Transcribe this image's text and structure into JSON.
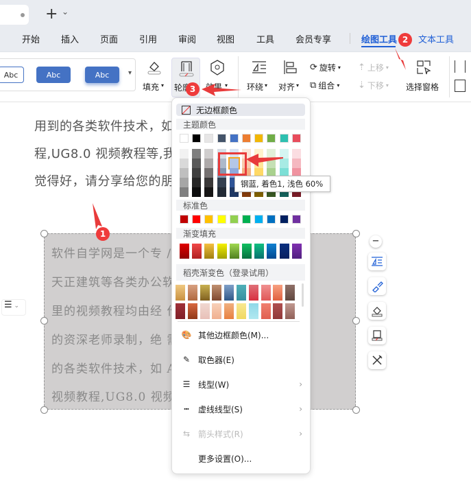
{
  "tabbar": {
    "new_tab": "+",
    "new_tab_menu": "⌄"
  },
  "menu": {
    "items": [
      "开始",
      "插入",
      "页面",
      "引用",
      "审阅",
      "视图",
      "工具",
      "会员专享"
    ],
    "drawing_tools": "绘图工具",
    "text_tools": "文本工具"
  },
  "ribbon": {
    "styles": [
      "Abc",
      "Abc",
      "Abc"
    ],
    "fill": "填充",
    "outline": "轮廓",
    "effect": "效果",
    "wrap": "环绕",
    "align": "对齐",
    "rotate": "旋转",
    "group": "组合",
    "move_up": "上移",
    "move_down": "下移",
    "selection_pane": "选择窗格"
  },
  "document": {
    "lines": [
      "用到的各类软件技术，如                           程,Pro/E5.0 视频教",
      "程,UG8.0 视频教程等,我                          软件自学网。如果您",
      "觉得好，请分享给您的朋"
    ]
  },
  "textbox": {
    "lines": [
      "软件自学网是一个专                          /E, PS,",
      "天正建筑等各类办公软                        ，本站",
      "里的视频教程均由经                          作经验",
      "的资深老师录制，绝                          需用到",
      "的各类软件技术，如 A                        o/E5.0",
      "视频教程,UG8.0 视频"
    ]
  },
  "dropdown": {
    "no_border": "无边框颜色",
    "theme_header": "主题颜色",
    "standard_header": "标准色",
    "gradient_header": "渐变填充",
    "docer_header": "稻壳渐变色（登录试用）",
    "theme_colors": [
      "#ffffff",
      "#000000",
      "#e7e6e6",
      "#44546a",
      "#4472c4",
      "#ed7d31",
      "#f2b705",
      "#70ad47",
      "#2ec0b0",
      "#e84c5c"
    ],
    "shades": [
      [
        "#f2f2f2",
        "#d9d9d9",
        "#bfbfbf",
        "#a6a6a6",
        "#808080"
      ],
      [
        "#7f7f7f",
        "#595959",
        "#3f3f3f",
        "#262626",
        "#0d0d0d"
      ],
      [
        "#d0cece",
        "#aeaaaa",
        "#757171",
        "#3a3838",
        "#171616"
      ],
      [
        "#d6dce4",
        "#adb9ca",
        "#8497b0",
        "#333f4f",
        "#222a35"
      ],
      [
        "#dae3f3",
        "#b4c7e7",
        "#8faadc",
        "#2f5597",
        "#1f3864"
      ],
      [
        "#fbe5d6",
        "#f8cbad",
        "#f4b183",
        "#c55a11",
        "#843c0c"
      ],
      [
        "#fff2cc",
        "#ffe699",
        "#ffd966",
        "#bf9000",
        "#7f6000"
      ],
      [
        "#e2f0d9",
        "#c5e0b4",
        "#a9d18e",
        "#548235",
        "#385723"
      ],
      [
        "#d5f5f2",
        "#a8ebe4",
        "#7ddfd6",
        "#1e9087",
        "#14605a"
      ],
      [
        "#fbdde1",
        "#f5b8c0",
        "#f093a0",
        "#b42a3a",
        "#781c27"
      ]
    ],
    "selected": {
      "column": 4,
      "row": 1
    },
    "standard_colors": [
      "#c00000",
      "#ff0000",
      "#ffc000",
      "#ffff00",
      "#92d050",
      "#00b050",
      "#00b0f0",
      "#0070c0",
      "#002060",
      "#7030a0"
    ],
    "gradients": [
      [
        "#e00000",
        "#900000"
      ],
      [
        "#f04848",
        "#b02020"
      ],
      [
        "#f5c040",
        "#a08010"
      ],
      [
        "#f5f000",
        "#a0a000"
      ],
      [
        "#a0d850",
        "#508020"
      ],
      [
        "#10c060",
        "#087040"
      ],
      [
        "#10c080",
        "#087070"
      ],
      [
        "#1080d0",
        "#004890"
      ],
      [
        "#0a3080",
        "#0a2060"
      ],
      [
        "#8030b0",
        "#502080"
      ]
    ],
    "docer_row1": [
      [
        "#f0c880",
        "#c89040"
      ],
      [
        "#d8a080",
        "#b06840"
      ],
      [
        "#c8b050",
        "#806020"
      ],
      [
        "#c09070",
        "#804830"
      ],
      [
        "#80a0c8",
        "#305888"
      ],
      [
        "#50b0b8",
        "#3890a0"
      ],
      [
        "#e07078",
        "#d83040"
      ],
      [
        "#f09090",
        "#e05858"
      ],
      [
        "#f8a080",
        "#e06040"
      ],
      [
        "#907068",
        "#604840"
      ]
    ],
    "docer_row2": [
      [
        "#a03038",
        "#802028"
      ],
      [
        "#d86840",
        "#903818"
      ],
      [
        "#f0d8d0",
        "#e8c0b8"
      ],
      [
        "#f8d0b8",
        "#f0b090"
      ],
      [
        "#f0b080",
        "#e88040"
      ],
      [
        "#f8e890",
        "#f0d860"
      ],
      [
        "#90d8e8",
        "#b0e8f0"
      ],
      [
        "#f08070",
        "#e06050"
      ],
      [
        "#b05050",
        "#903838"
      ],
      [
        "#c09890",
        "#906058"
      ]
    ],
    "tooltip": "钢蓝, 着色1, 浅色 60%",
    "items": [
      {
        "label": "其他边框颜色(M)...",
        "icon": "palette-icon"
      },
      {
        "label": "取色器(E)",
        "icon": "eyedropper-icon"
      },
      {
        "label": "线型(W)",
        "icon": "line-weight-icon",
        "submenu": true
      },
      {
        "label": "虚线线型(S)",
        "icon": "dash-type-icon",
        "submenu": true
      },
      {
        "label": "箭头样式(R)",
        "icon": "arrow-style-icon",
        "submenu": true,
        "disabled": true
      },
      {
        "label": "更多设置(O)...",
        "icon": ""
      }
    ]
  },
  "annotations": {
    "b1": "1",
    "b2": "2",
    "b3": "3"
  },
  "colors": {
    "accent": "#1f5fd6",
    "annotation": "#ef3b3b"
  }
}
